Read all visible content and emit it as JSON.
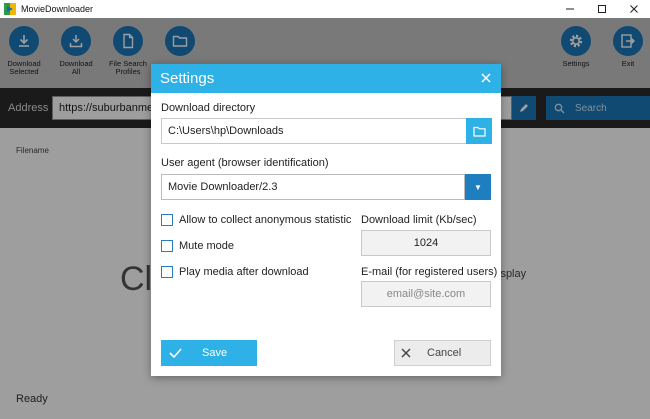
{
  "window": {
    "title": "MovieDownloader",
    "controls": [
      "minimize",
      "maximize",
      "close"
    ]
  },
  "toolbar": {
    "download_selected": "Download\nSelected",
    "download_all": "Download\nAll",
    "file_search_profiles": "File Search\nProfiles",
    "settings": "Settings",
    "exit": "Exit"
  },
  "address": {
    "label": "Address",
    "value": "https://suburbanmen"
  },
  "search": {
    "label": "Search"
  },
  "main": {
    "filename_header": "Filename",
    "partial_text_left": "Cl",
    "partial_text_right": "isplay",
    "status": "Ready"
  },
  "dialog": {
    "title": "Settings",
    "download_directory_label": "Download directory",
    "download_directory_value": "C:\\Users\\hp\\Downloads",
    "user_agent_label": "User agent (browser identification)",
    "user_agent_value": "Movie Downloader/2.3",
    "checkboxes": [
      {
        "label": "Allow to collect anonymous statistic",
        "checked": false
      },
      {
        "label": "Mute mode",
        "checked": false
      },
      {
        "label": "Play media after download",
        "checked": false
      }
    ],
    "download_limit_label": "Download limit (Kb/sec)",
    "download_limit_value": "1024",
    "email_label": "E-mail (for registered users)",
    "email_placeholder": "email@site.com",
    "save_label": "Save",
    "cancel_label": "Cancel"
  },
  "colors": {
    "accent": "#2db1e6",
    "toolbar_icon": "#1a78b8",
    "toolbar_bg": "#c4c4c4"
  }
}
